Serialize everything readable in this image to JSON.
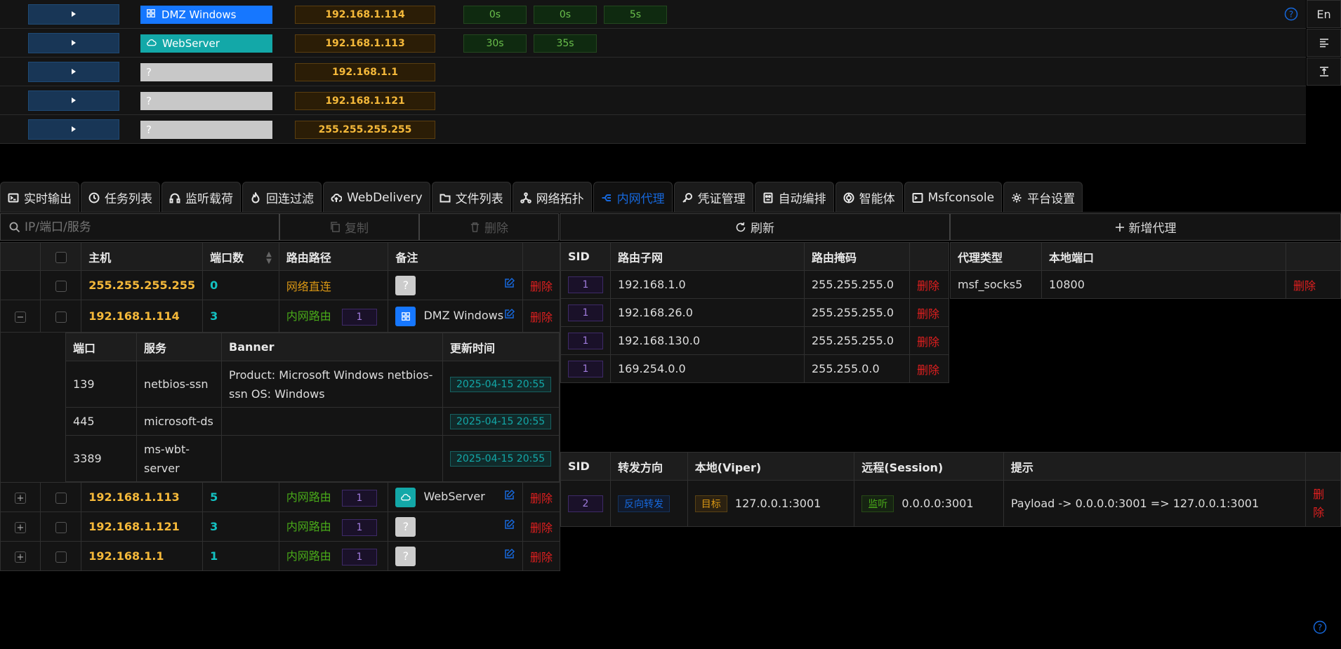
{
  "hosts": [
    {
      "tag": "DMZ Windows",
      "tag_icon": "windows-icon",
      "tag_color": "#1677ff",
      "ip": "192.168.1.114",
      "chips": [
        "0s",
        "0s",
        "5s"
      ]
    },
    {
      "tag": "WebServer",
      "tag_icon": "cloud-icon",
      "tag_color": "#13a8a8",
      "ip": "192.168.1.113",
      "chips": [
        "30s",
        "35s"
      ]
    },
    {
      "tag": "?",
      "tag_icon": "",
      "tag_color": "#c8c8c8",
      "ip": "192.168.1.1",
      "chips": []
    },
    {
      "tag": "?",
      "tag_icon": "",
      "tag_color": "#c8c8c8",
      "ip": "192.168.1.121",
      "chips": []
    },
    {
      "tag": "?",
      "tag_icon": "",
      "tag_color": "#c8c8c8",
      "ip": "255.255.255.255",
      "chips": []
    }
  ],
  "side": {
    "lang": "En"
  },
  "tabs": [
    {
      "label": "实时输出",
      "icon": "terminal-icon"
    },
    {
      "label": "任务列表",
      "icon": "clock-icon"
    },
    {
      "label": "监听载荷",
      "icon": "headphones-icon"
    },
    {
      "label": "回连过滤",
      "icon": "flame-icon"
    },
    {
      "label": "WebDelivery",
      "icon": "cloud-upload-icon"
    },
    {
      "label": "文件列表",
      "icon": "folder-icon"
    },
    {
      "label": "网络拓扑",
      "icon": "topology-icon"
    },
    {
      "label": "内网代理",
      "icon": "route-icon",
      "active": true
    },
    {
      "label": "凭证管理",
      "icon": "key-icon"
    },
    {
      "label": "自动编排",
      "icon": "robot-icon"
    },
    {
      "label": "智能体",
      "icon": "ai-icon"
    },
    {
      "label": "Msfconsole",
      "icon": "console-icon"
    },
    {
      "label": "平台设置",
      "icon": "gear-icon"
    }
  ],
  "toolbar": {
    "search_placeholder": "IP/端口/服务",
    "copy": "复制",
    "delete": "删除",
    "refresh": "刷新",
    "add_proxy": "新增代理"
  },
  "route_table": {
    "headers": {
      "host": "主机",
      "ports": "端口数",
      "path": "路由路径",
      "note": "备注"
    },
    "rows": [
      {
        "ip": "255.255.255.255",
        "count": "0",
        "path": "网络直连",
        "path_type": "direct",
        "sid": "",
        "note": "?",
        "note_icon": "",
        "delete": "删除"
      },
      {
        "ip": "192.168.1.114",
        "count": "3",
        "path": "内网路由",
        "path_type": "route",
        "sid": "1",
        "note": "DMZ Windows",
        "note_icon": "windows-icon",
        "delete": "删除",
        "expanded": true
      },
      {
        "ip": "192.168.1.113",
        "count": "5",
        "path": "内网路由",
        "path_type": "route",
        "sid": "1",
        "note": "WebServer",
        "note_icon": "cloud-icon",
        "delete": "删除"
      },
      {
        "ip": "192.168.1.121",
        "count": "3",
        "path": "内网路由",
        "path_type": "route",
        "sid": "1",
        "note": "?",
        "note_icon": "",
        "delete": "删除"
      },
      {
        "ip": "192.168.1.1",
        "count": "1",
        "path": "内网路由",
        "path_type": "route",
        "sid": "1",
        "note": "?",
        "note_icon": "",
        "delete": "删除"
      }
    ],
    "ports": {
      "headers": {
        "port": "端口",
        "service": "服务",
        "banner": "Banner",
        "time": "更新时间"
      },
      "rows": [
        {
          "port": "139",
          "service": "netbios-ssn",
          "banner": "Product: Microsoft Windows netbios-ssn OS: Windows",
          "time": "2025-04-15 20:55"
        },
        {
          "port": "445",
          "service": "microsoft-ds",
          "banner": "",
          "time": "2025-04-15 20:55"
        },
        {
          "port": "3389",
          "service": "ms-wbt-server",
          "banner": "",
          "time": "2025-04-15 20:55"
        }
      ]
    }
  },
  "subnet_table": {
    "headers": {
      "sid": "SID",
      "subnet": "路由子网",
      "mask": "路由掩码"
    },
    "rows": [
      {
        "sid": "1",
        "subnet": "192.168.1.0",
        "mask": "255.255.255.0",
        "delete": "删除"
      },
      {
        "sid": "1",
        "subnet": "192.168.26.0",
        "mask": "255.255.255.0",
        "delete": "删除"
      },
      {
        "sid": "1",
        "subnet": "192.168.130.0",
        "mask": "255.255.255.0",
        "delete": "删除"
      },
      {
        "sid": "1",
        "subnet": "169.254.0.0",
        "mask": "255.255.0.0",
        "delete": "删除"
      }
    ]
  },
  "proxy_table": {
    "headers": {
      "type": "代理类型",
      "port": "本地端口"
    },
    "rows": [
      {
        "type": "msf_socks5",
        "port": "10800",
        "delete": "删除"
      }
    ]
  },
  "forward_table": {
    "headers": {
      "sid": "SID",
      "direction": "转发方向",
      "local": "本地(Viper)",
      "remote": "远程(Session)",
      "hint": "提示"
    },
    "rows": [
      {
        "sid": "2",
        "direction": "反向转发",
        "local_tag": "目标",
        "local": "127.0.0.1:3001",
        "remote_tag": "监听",
        "remote": "0.0.0.0:3001",
        "hint": "Payload -> 0.0.0.0:3001 => 127.0.0.1:3001",
        "delete": "删除"
      }
    ]
  }
}
